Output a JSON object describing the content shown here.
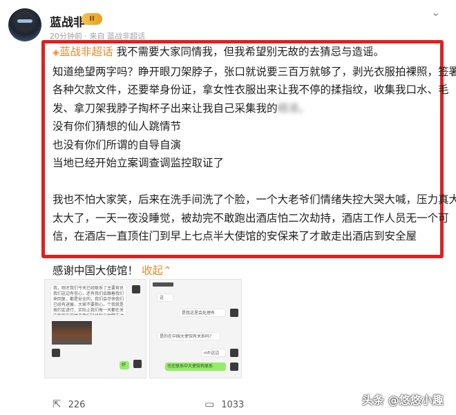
{
  "header": {
    "username": "蓝战非",
    "vip_level": "II",
    "meta": "20分钟前 · 来自 蓝战非超话"
  },
  "post": {
    "topic": "蓝战非超话",
    "lines": [
      "我不需要大家同情我，但我希望别无故的去猜忌与造谣。",
      "知道绝望两字吗？睁开眼刀架脖子，张口就说要三百万就够了，剥光衣服拍裸照，签署",
      "各种欠款文件，还要举身份证，拿女性衣服出来让我不停的揉指纹，收集我口水、毛",
      "发、拿刀架我脖子掏杯子出来让我自己采集我的",
      "没有你们猜想的仙人跳情节",
      "也没有你们所谓的自导自演",
      "当地已经开始立案调查调监控取证了",
      "我也不怕大家笑，后来在洗手间洗了个脸，一个大老爷们情绪失控大哭大喊，压力真大",
      "太大了，一天一夜没睡觉，被劫完不敢跑出酒店怕二次劫持，酒店工作人员无一个可",
      "信，在酒店一直顶住门到早上七点半大使馆的安保来了才敢走出酒店到安全屋"
    ],
    "blurred_tail": "精液。"
  },
  "thanks": {
    "text": "感谢中国大使馆！",
    "collapse_label": "收起"
  },
  "chat_left": {
    "message": "我，刚才我们今天已经联系了主要官员我们这边有信心，还有我们会跟着我们来回复，都是安全的，我们会尽快我们已经有进展，大家不要担心，个我就是按约定进行，实际上我们每一天都在关注你现在的状态我们已经和当地警方对接",
    "reply": "好"
  },
  "chat_right": {
    "msg1": "这个？",
    "msg2": "是我这里会处理有",
    "msg3": "是的在中国大使馆有关系吗？",
    "msg4": "mfr这边",
    "msg5": "也在联系中大使馆有联系"
  },
  "actions": {
    "shares": "226",
    "comments": "1033"
  },
  "watermark": "头条 @悠悠小趣",
  "colors": {
    "accent": "#e8892b",
    "highlight_border": "#e02020",
    "wechat_green": "#95ec69"
  }
}
